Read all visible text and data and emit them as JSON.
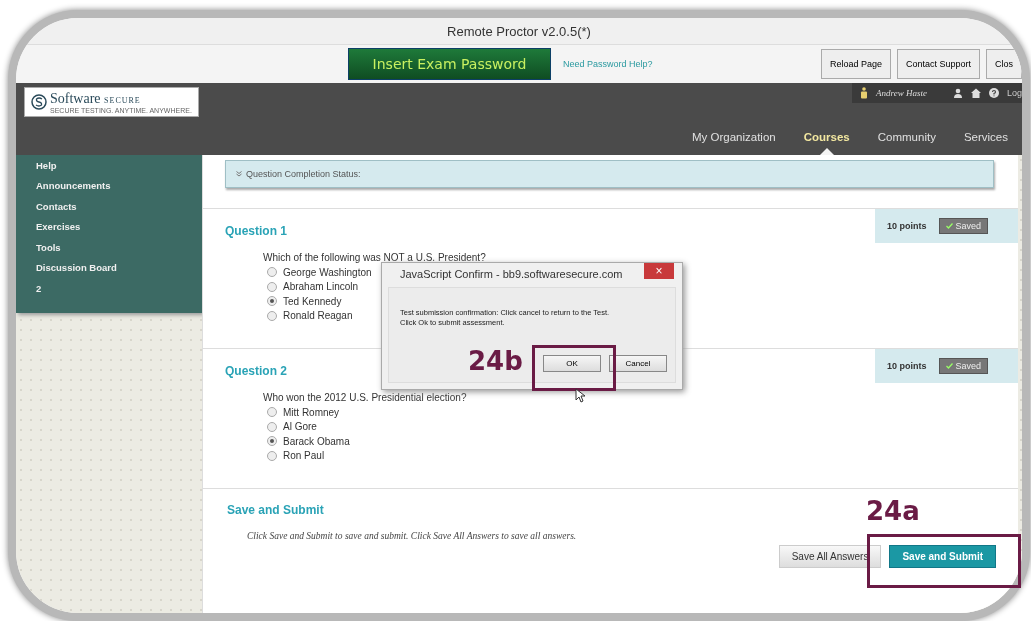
{
  "window": {
    "title": "Remote Proctor v2.0.5(*)"
  },
  "toolbar": {
    "primary_button": "Insert Exam Password",
    "help_link": "Need Password Help?",
    "buttons": [
      "Reload Page",
      "Contact Support",
      "Clos"
    ]
  },
  "header": {
    "logo": {
      "name": "Software",
      "name_suffix": "SECURE",
      "tagline": "SECURE TESTING. ANYTIME. ANYWHERE."
    },
    "user": "Andrew Haste",
    "cut_link": "Log",
    "nav": [
      {
        "label": "My Organization",
        "selected": false
      },
      {
        "label": "Courses",
        "selected": true
      },
      {
        "label": "Community",
        "selected": false
      },
      {
        "label": "Services",
        "selected": false
      }
    ]
  },
  "sidebar": {
    "items": [
      "Help",
      "Announcements",
      "Contacts",
      "Exercises",
      "Tools",
      "Discussion Board",
      "2"
    ]
  },
  "completion_status": "Question Completion Status:",
  "questions": [
    {
      "title": "Question 1",
      "points": "10 points",
      "status": "Saved",
      "prompt": "Which of the following was NOT a U.S. President?",
      "options": [
        {
          "label": "George Washington",
          "selected": false
        },
        {
          "label": "Abraham Lincoln",
          "selected": false
        },
        {
          "label": "Ted Kennedy",
          "selected": true
        },
        {
          "label": "Ronald Reagan",
          "selected": false
        }
      ]
    },
    {
      "title": "Question 2",
      "points": "10 points",
      "status": "Saved",
      "prompt": "Who won the 2012 U.S. Presidential election?",
      "options": [
        {
          "label": "Mitt Romney",
          "selected": false
        },
        {
          "label": "Al Gore",
          "selected": false
        },
        {
          "label": "Barack Obama",
          "selected": true
        },
        {
          "label": "Ron Paul",
          "selected": false
        }
      ]
    }
  ],
  "save_section": {
    "title": "Save and Submit",
    "instructions": "Click Save and Submit to save and submit. Click Save All Answers to save all answers.",
    "buttons": [
      {
        "label": "Save All Answers",
        "kind": "secondary"
      },
      {
        "label": "Save and Submit",
        "kind": "primary"
      }
    ]
  },
  "dialog": {
    "title": "JavaScript Confirm - bb9.softwaresecure.com",
    "close": "×",
    "message": "Test submission confirmation: Click cancel to return to the Test.\nClick Ok to submit assessment.",
    "buttons": [
      "OK",
      "Cancel"
    ]
  },
  "annotations": [
    {
      "label": "24b"
    },
    {
      "label": "24a"
    }
  ]
}
